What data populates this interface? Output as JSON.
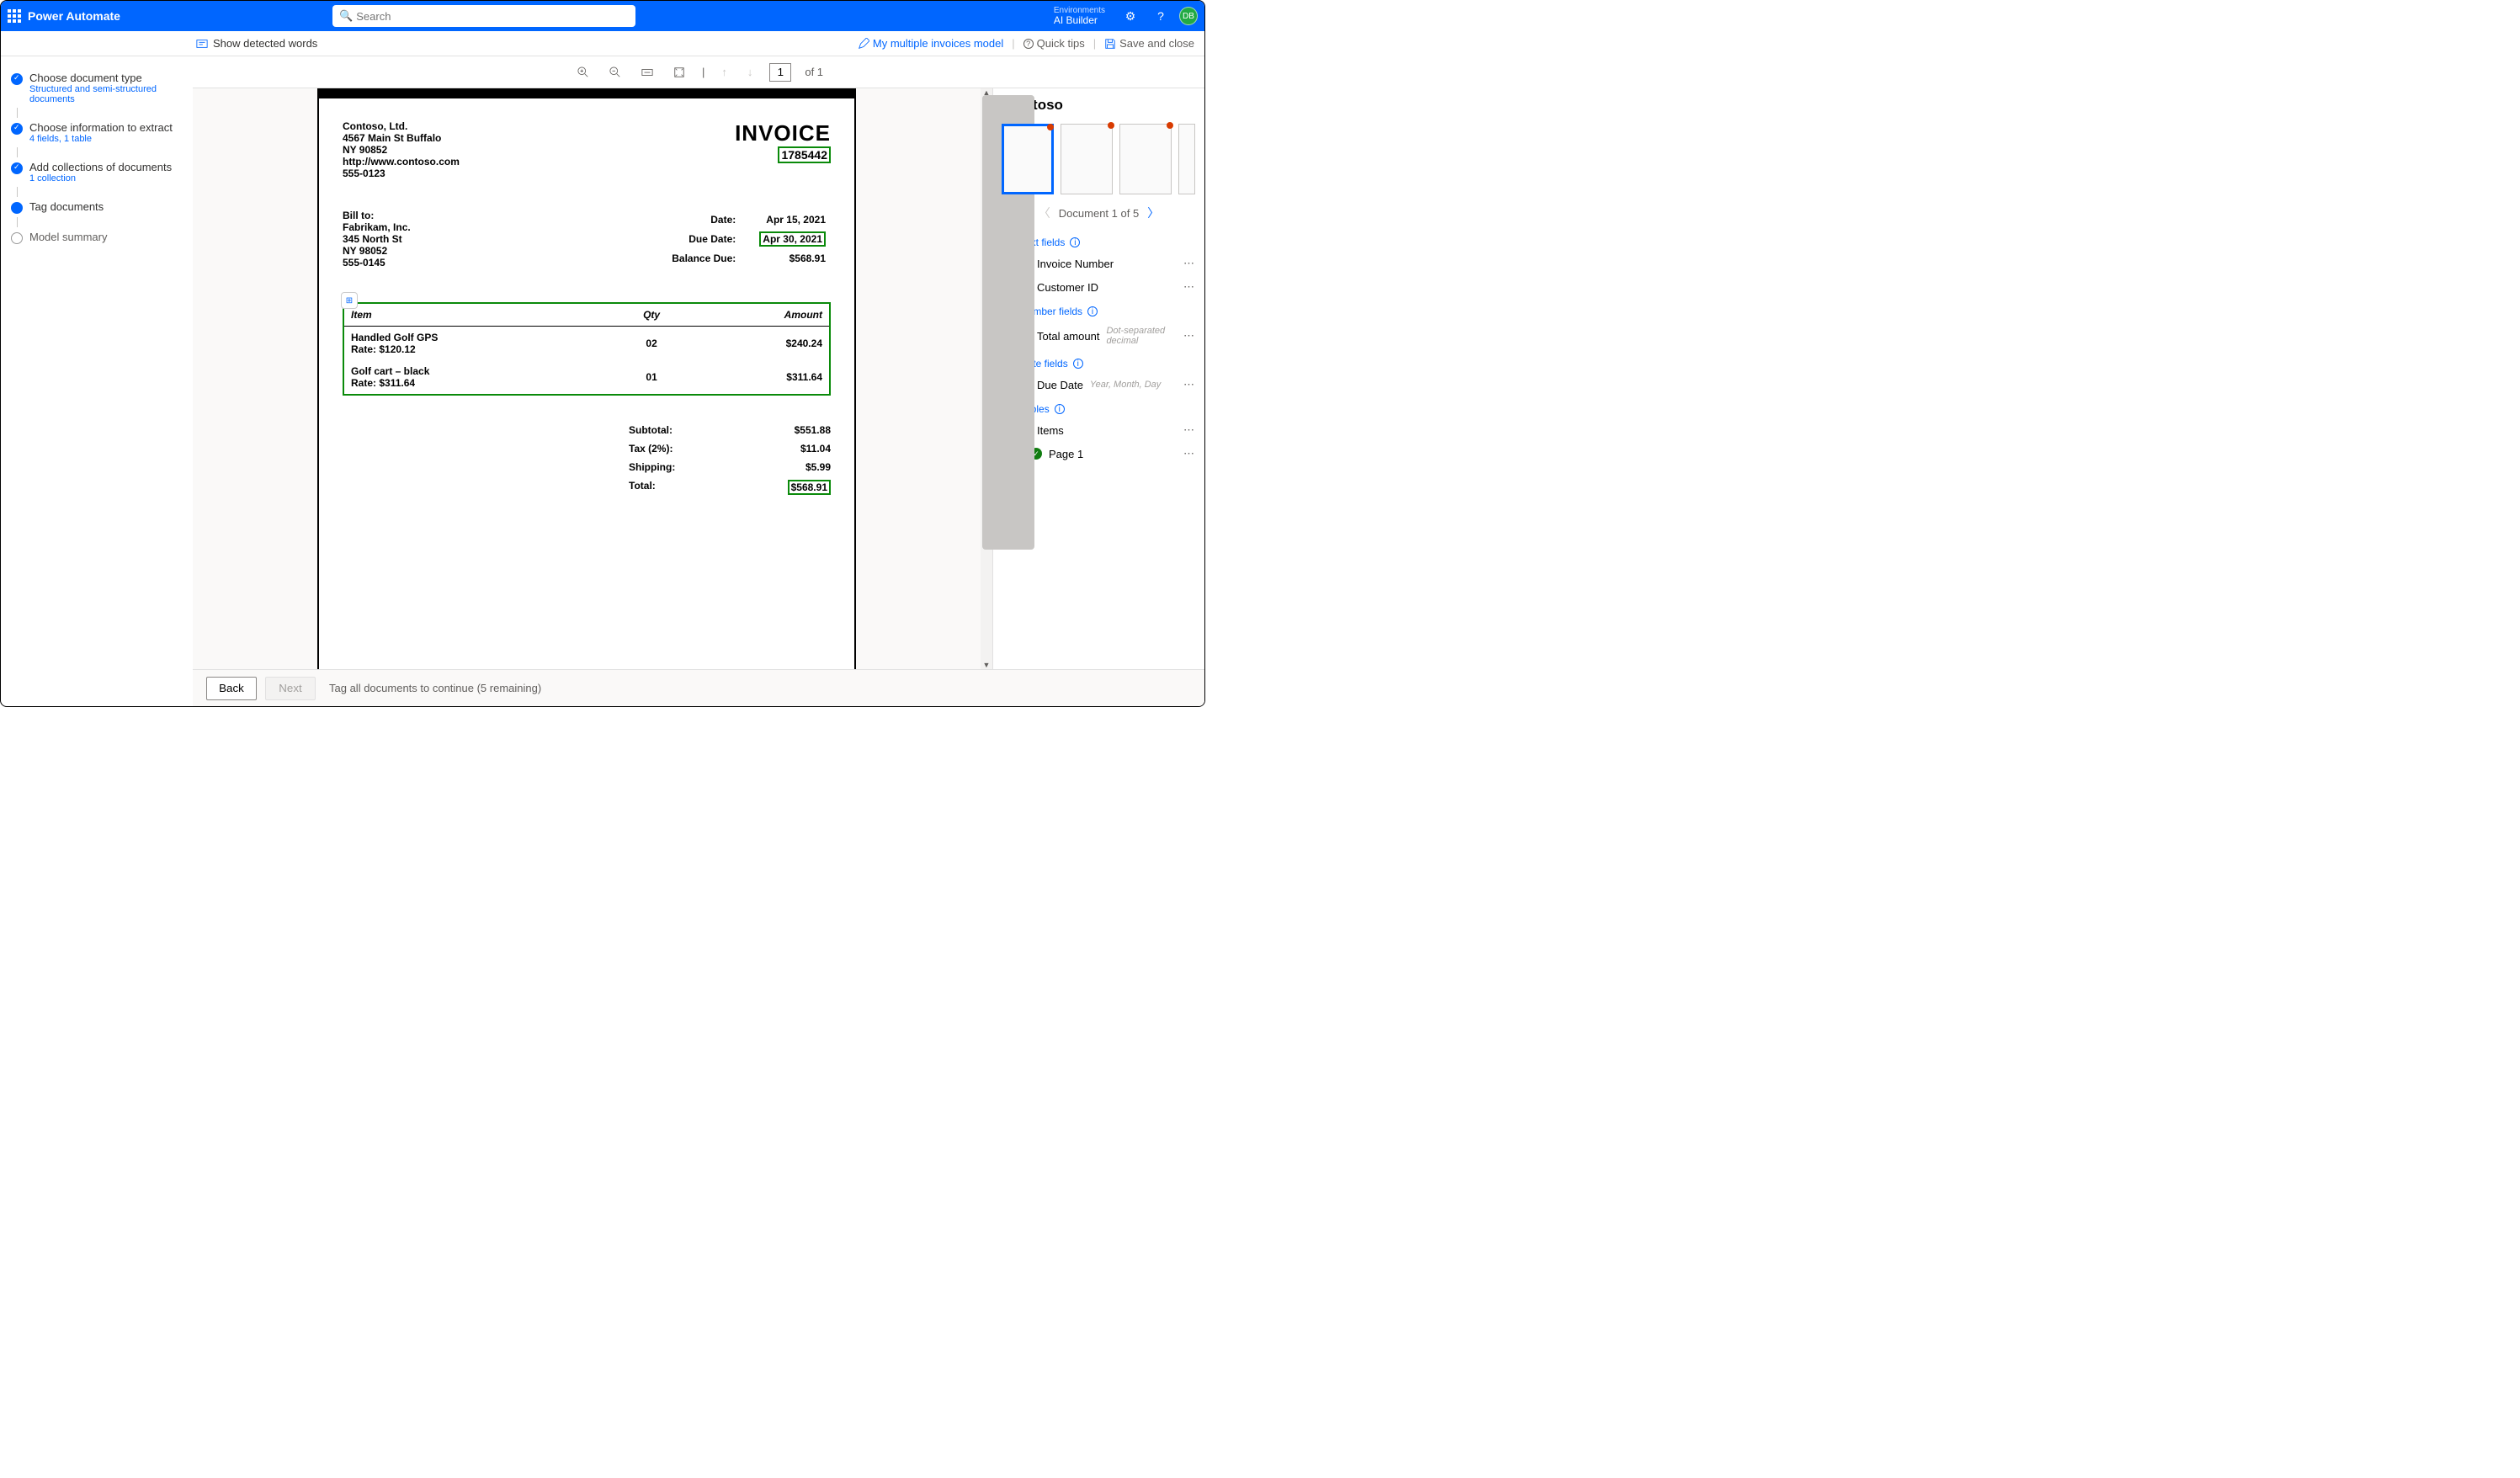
{
  "header": {
    "brand": "Power Automate",
    "search_placeholder": "Search",
    "env_label": "Environments",
    "env_name": "AI Builder",
    "avatar": "DB"
  },
  "subbar": {
    "show_words": "Show detected words",
    "model_link": "My multiple invoices model",
    "quick_tips": "Quick tips",
    "save": "Save and close"
  },
  "steps": [
    {
      "title": "Choose document type",
      "sub": "Structured and semi-structured documents",
      "state": "done"
    },
    {
      "title": "Choose information to extract",
      "sub": "4 fields, 1 table",
      "state": "done"
    },
    {
      "title": "Add collections of documents",
      "sub": "1 collection",
      "state": "done"
    },
    {
      "title": "Tag documents",
      "sub": "",
      "state": "active"
    },
    {
      "title": "Model summary",
      "sub": "",
      "state": "pending"
    }
  ],
  "toolbar": {
    "page_current": "1",
    "page_total": "of 1"
  },
  "doc": {
    "company": "Contoso, Ltd.",
    "addr1": "4567 Main St Buffalo",
    "addr2": "NY 90852",
    "url": "http://www.contoso.com",
    "phone": "555-0123",
    "title": "INVOICE",
    "invno": "1785442",
    "billto_label": "Bill to:",
    "bill_name": "Fabrikam, Inc.",
    "bill_addr1": "345 North St",
    "bill_addr2": "NY 98052",
    "bill_phone": "555-0145",
    "date_l": "Date:",
    "date_v": "Apr 15, 2021",
    "due_l": "Due Date:",
    "due_v": "Apr 30, 2021",
    "bal_l": "Balance Due:",
    "bal_v": "$568.91",
    "th_item": "Item",
    "th_qty": "Qty",
    "th_amt": "Amount",
    "rows": [
      {
        "n": "Handled Golf GPS",
        "r": "Rate: $120.12",
        "q": "02",
        "a": "$240.24"
      },
      {
        "n": "Golf cart – black",
        "r": "Rate: $311.64",
        "q": "01",
        "a": "$311.64"
      }
    ],
    "sub_l": "Subtotal:",
    "sub_v": "$551.88",
    "tax_l": "Tax (2%):",
    "tax_v": "$11.04",
    "ship_l": "Shipping:",
    "ship_v": "$5.99",
    "tot_l": "Total:",
    "tot_v": "$568.91"
  },
  "right": {
    "title": "Contoso",
    "doc_counter": "Document 1 of 5",
    "s_text": "Text fields",
    "s_num": "Number fields",
    "s_date": "Date fields",
    "s_tables": "Tables",
    "f_invno": "Invoice Number",
    "f_cust": "Customer ID",
    "f_total": "Total amount",
    "f_total_h": "Dot-separated decimal",
    "f_due": "Due Date",
    "f_due_h": "Year, Month, Day",
    "f_items": "Items",
    "f_page1": "Page 1"
  },
  "footer": {
    "back": "Back",
    "next": "Next",
    "msg": "Tag all documents to continue (5 remaining)"
  }
}
